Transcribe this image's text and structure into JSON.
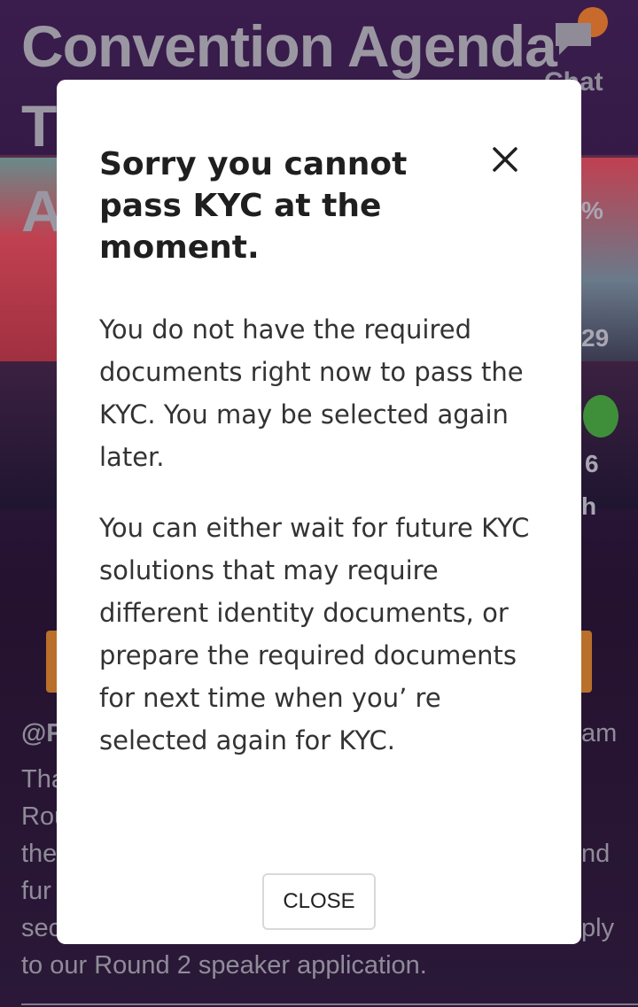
{
  "background": {
    "title_line1": "Convention Agenda",
    "title_line2": "T",
    "title_line3": "A",
    "chat_label": "Chat",
    "stat_percent": "%",
    "stat_number": "29",
    "stat_6": "6",
    "stat_h": "h",
    "handle_fragment": "@F",
    "right_fragment_1": "am",
    "line_fragment_1": "Tha",
    "line_fragment_2": "Rou",
    "line_fragment_3": "the",
    "line_fragment_3_right": "nd",
    "line_fragment_4": "fur",
    "line_fragment_5": "sec",
    "line_fragment_5_right": "ply",
    "last_line": "to our Round 2 speaker application."
  },
  "modal": {
    "title": "Sorry you cannot pass KYC at the moment.",
    "paragraph1": "You do not have the required documents right now to pass the KYC. You may be selected again later.",
    "paragraph2": "You can either wait for future KYC solutions that may require different identity documents, or prepare the required documents for next time when you’ re selected again for KYC.",
    "close_button": "CLOSE"
  },
  "colors": {
    "overlay": "#2a1638",
    "modal_bg": "#ffffff",
    "accent_orange": "#c86a2b",
    "accent_green": "#3f8f3a"
  },
  "icons": [
    "chat-icon",
    "close-icon"
  ]
}
